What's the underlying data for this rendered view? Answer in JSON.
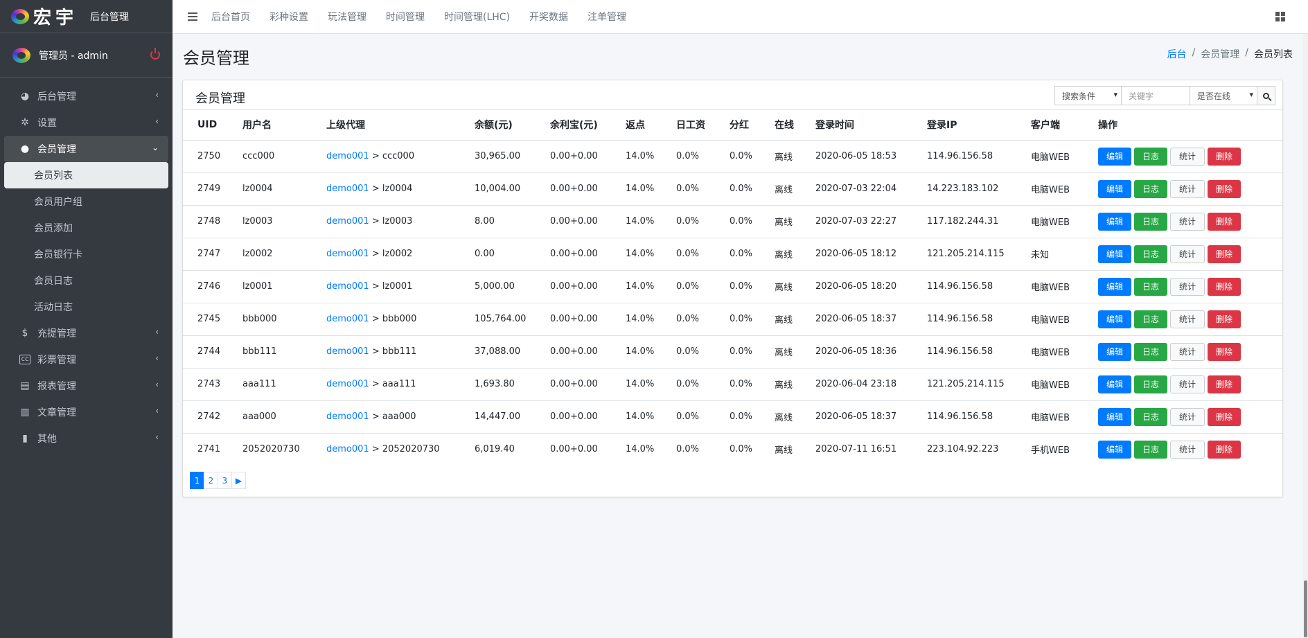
{
  "brand": {
    "name": "宏宇",
    "subtitle": "后台管理"
  },
  "user": {
    "name": "管理员 - admin"
  },
  "sidebar": {
    "items": [
      {
        "label": "后台管理",
        "icon": "dashboard-icon"
      },
      {
        "label": "设置",
        "icon": "gear-icon"
      },
      {
        "label": "会员管理",
        "icon": "user-icon"
      },
      {
        "label": "充提管理",
        "icon": "dollar-icon"
      },
      {
        "label": "彩票管理",
        "icon": "cc-icon"
      },
      {
        "label": "报表管理",
        "icon": "file-icon"
      },
      {
        "label": "文章管理",
        "icon": "book-icon"
      },
      {
        "label": "其他",
        "icon": "trash-icon"
      }
    ],
    "submenu": [
      "会员列表",
      "会员用户组",
      "会员添加",
      "会员银行卡",
      "会员日志",
      "活动日志"
    ]
  },
  "topnav": [
    "后台首页",
    "彩种设置",
    "玩法管理",
    "时间管理",
    "时间管理(LHC)",
    "开奖数据",
    "注单管理"
  ],
  "page": {
    "title": "会员管理",
    "breadcrumb": [
      "后台",
      "/",
      "会员管理",
      "/",
      "会员列表"
    ]
  },
  "card": {
    "title": "会员管理",
    "search": {
      "condition": "搜索条件",
      "keyword_placeholder": "关键字",
      "online": "是否在线"
    }
  },
  "table": {
    "headers": [
      "UID",
      "用户名",
      "上级代理",
      "余额(元)",
      "余利宝(元)",
      "返点",
      "日工资",
      "分红",
      "在线",
      "登录时间",
      "登录IP",
      "客户端",
      "操作"
    ],
    "actions": {
      "edit": "编辑",
      "log": "日志",
      "stat": "统计",
      "del": "删除"
    },
    "rows": [
      {
        "uid": "2750",
        "user": "ccc000",
        "agent": "demo001",
        "agent_tail": " > ccc000",
        "balance": "30,965.00",
        "yulibao": "0.00+0.00",
        "rebate": "14.0%",
        "wage": "0.0%",
        "bonus": "0.0%",
        "online": "离线",
        "time": "2020-06-05 18:53",
        "ip": "114.96.156.58",
        "client": "电脑WEB"
      },
      {
        "uid": "2749",
        "user": "lz0004",
        "agent": "demo001",
        "agent_tail": " > lz0004",
        "balance": "10,004.00",
        "yulibao": "0.00+0.00",
        "rebate": "14.0%",
        "wage": "0.0%",
        "bonus": "0.0%",
        "online": "离线",
        "time": "2020-07-03 22:04",
        "ip": "14.223.183.102",
        "client": "电脑WEB"
      },
      {
        "uid": "2748",
        "user": "lz0003",
        "agent": "demo001",
        "agent_tail": " > lz0003",
        "balance": "8.00",
        "yulibao": "0.00+0.00",
        "rebate": "14.0%",
        "wage": "0.0%",
        "bonus": "0.0%",
        "online": "离线",
        "time": "2020-07-03 22:27",
        "ip": "117.182.244.31",
        "client": "电脑WEB"
      },
      {
        "uid": "2747",
        "user": "lz0002",
        "agent": "demo001",
        "agent_tail": " > lz0002",
        "balance": "0.00",
        "yulibao": "0.00+0.00",
        "rebate": "14.0%",
        "wage": "0.0%",
        "bonus": "0.0%",
        "online": "离线",
        "time": "2020-06-05 18:12",
        "ip": "121.205.214.115",
        "client": "未知"
      },
      {
        "uid": "2746",
        "user": "lz0001",
        "agent": "demo001",
        "agent_tail": " > lz0001",
        "balance": "5,000.00",
        "yulibao": "0.00+0.00",
        "rebate": "14.0%",
        "wage": "0.0%",
        "bonus": "0.0%",
        "online": "离线",
        "time": "2020-06-05 18:20",
        "ip": "114.96.156.58",
        "client": "电脑WEB"
      },
      {
        "uid": "2745",
        "user": "bbb000",
        "agent": "demo001",
        "agent_tail": " > bbb000",
        "balance": "105,764.00",
        "yulibao": "0.00+0.00",
        "rebate": "14.0%",
        "wage": "0.0%",
        "bonus": "0.0%",
        "online": "离线",
        "time": "2020-06-05 18:37",
        "ip": "114.96.156.58",
        "client": "电脑WEB"
      },
      {
        "uid": "2744",
        "user": "bbb111",
        "agent": "demo001",
        "agent_tail": " > bbb111",
        "balance": "37,088.00",
        "yulibao": "0.00+0.00",
        "rebate": "14.0%",
        "wage": "0.0%",
        "bonus": "0.0%",
        "online": "离线",
        "time": "2020-06-05 18:36",
        "ip": "114.96.156.58",
        "client": "电脑WEB"
      },
      {
        "uid": "2743",
        "user": "aaa111",
        "agent": "demo001",
        "agent_tail": " > aaa111",
        "balance": "1,693.80",
        "yulibao": "0.00+0.00",
        "rebate": "14.0%",
        "wage": "0.0%",
        "bonus": "0.0%",
        "online": "离线",
        "time": "2020-06-04 23:18",
        "ip": "121.205.214.115",
        "client": "电脑WEB"
      },
      {
        "uid": "2742",
        "user": "aaa000",
        "agent": "demo001",
        "agent_tail": " > aaa000",
        "balance": "14,447.00",
        "yulibao": "0.00+0.00",
        "rebate": "14.0%",
        "wage": "0.0%",
        "bonus": "0.0%",
        "online": "离线",
        "time": "2020-06-05 18:37",
        "ip": "114.96.156.58",
        "client": "电脑WEB"
      },
      {
        "uid": "2741",
        "user": "2052020730",
        "agent": "demo001",
        "agent_tail": " > 2052020730",
        "balance": "6,019.40",
        "yulibao": "0.00+0.00",
        "rebate": "14.0%",
        "wage": "0.0%",
        "bonus": "0.0%",
        "online": "离线",
        "time": "2020-07-11 16:51",
        "ip": "223.104.92.223",
        "client": "手机WEB"
      }
    ]
  },
  "pagination": {
    "pages": [
      "1",
      "2",
      "3"
    ],
    "next": "▶",
    "current": "1"
  },
  "colors": {
    "sidebar_bg": "#343a40",
    "primary": "#007bff",
    "success": "#28a745",
    "danger": "#dc3545"
  }
}
